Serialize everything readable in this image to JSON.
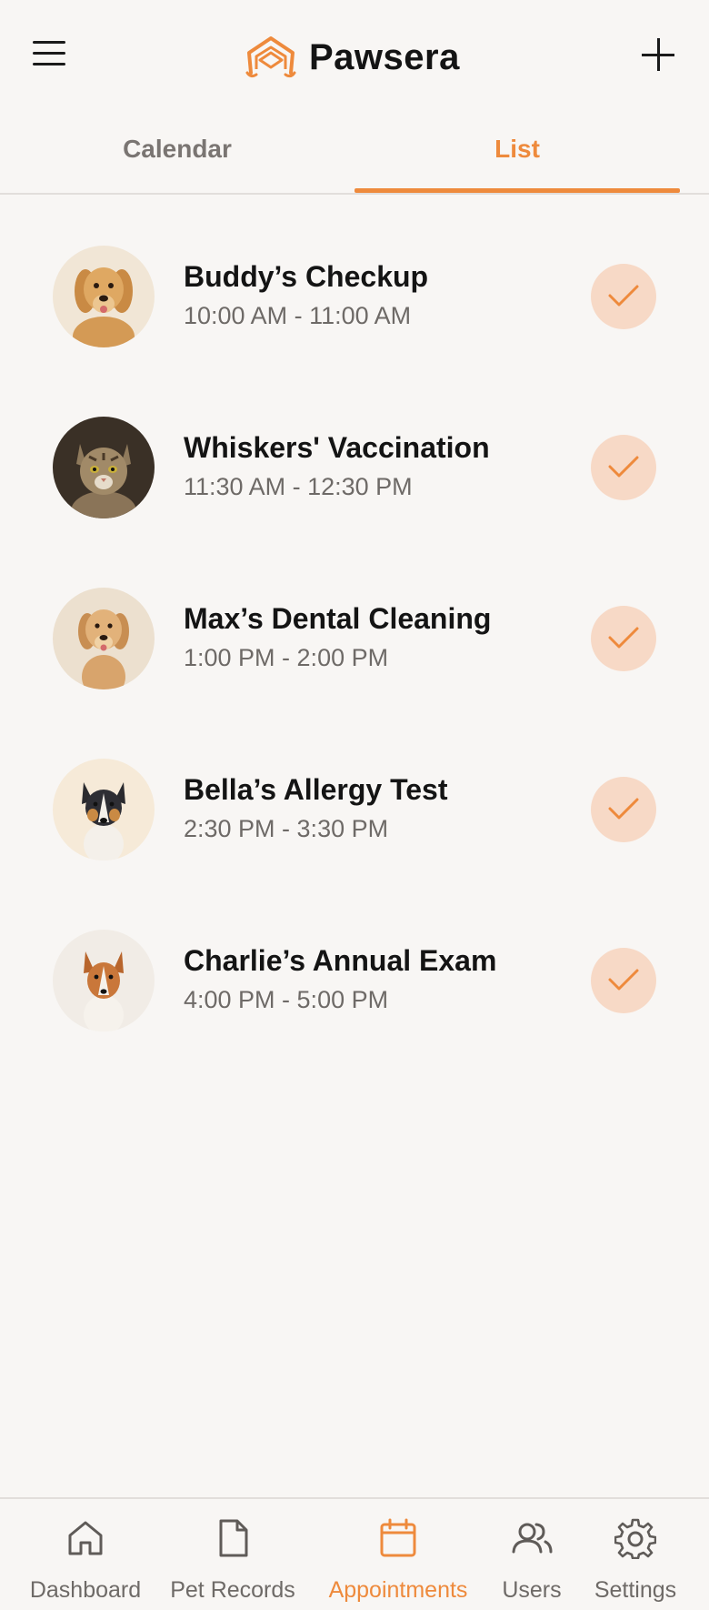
{
  "app": {
    "name": "Pawsera"
  },
  "header": {
    "menu_icon": "hamburger-menu-icon",
    "add_icon": "plus-icon",
    "logo_icon": "paw-house-logo-icon"
  },
  "tabs": [
    {
      "label": "Calendar",
      "active": false
    },
    {
      "label": "List",
      "active": true
    }
  ],
  "appointments": [
    {
      "title": "Buddy’s Checkup",
      "time": "10:00 AM - 11:00 AM",
      "avatar": "golden-retriever-avatar"
    },
    {
      "title": "Whiskers' Vaccination",
      "time": "11:30 AM - 12:30 PM",
      "avatar": "tabby-cat-avatar"
    },
    {
      "title": "Max’s Dental Cleaning",
      "time": "1:00 PM - 2:00 PM",
      "avatar": "golden-puppy-avatar"
    },
    {
      "title": "Bella’s Allergy Test",
      "time": "2:30 PM - 3:30 PM",
      "avatar": "collie-dog-avatar"
    },
    {
      "title": "Charlie’s Annual Exam",
      "time": "4:00 PM - 5:00 PM",
      "avatar": "sheltie-dog-avatar"
    }
  ],
  "bottom_nav": [
    {
      "label": "Dashboard",
      "icon": "home-icon",
      "active": false
    },
    {
      "label": "Pet Records",
      "icon": "document-icon",
      "active": false
    },
    {
      "label": "Appointments",
      "icon": "calendar-icon",
      "active": true
    },
    {
      "label": "Users",
      "icon": "users-icon",
      "active": false
    },
    {
      "label": "Settings",
      "icon": "gear-icon",
      "active": false
    }
  ],
  "colors": {
    "accent": "#ee8a3c",
    "background": "#f8f6f4",
    "check_bg": "#f7d9c6",
    "text": "#141414",
    "muted": "#6e6a67"
  }
}
